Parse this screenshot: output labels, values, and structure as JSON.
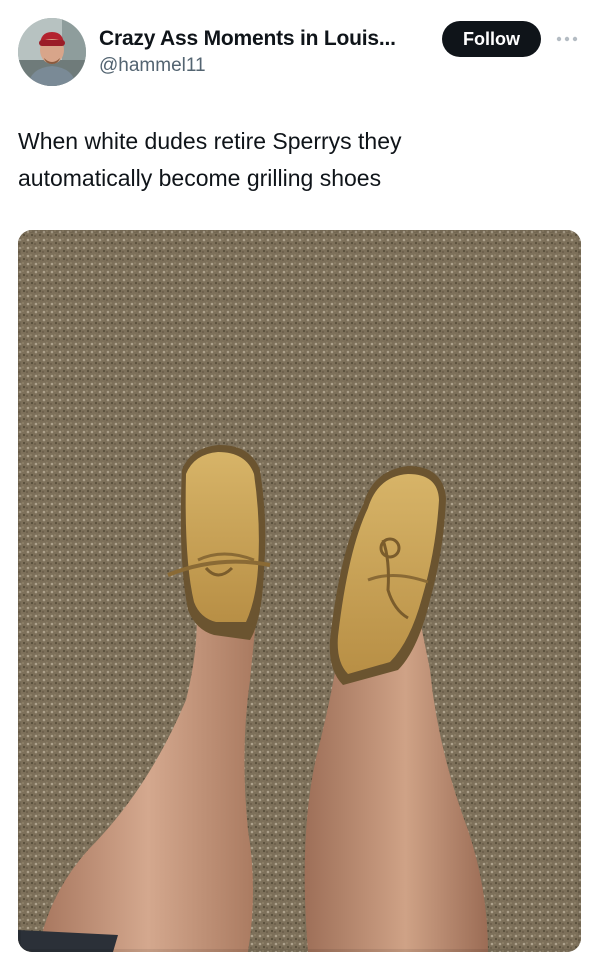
{
  "author": {
    "display_name": "Crazy Ass Moments in Louis...",
    "handle": "@hammel11",
    "avatar_icon": "profile-photo"
  },
  "actions": {
    "follow_label": "Follow",
    "more_icon": "more-horizontal-icon"
  },
  "tweet": {
    "text_line_1": "When white dudes retire Sperrys they",
    "text_line_2": "automatically become grilling shoes"
  },
  "media": {
    "type": "photo",
    "subject_icon": "legs-in-boat-shoes-on-carpet-photo"
  },
  "colors": {
    "text_primary": "#0f1419",
    "text_secondary": "#536471",
    "follow_bg": "#0f1419",
    "follow_text": "#ffffff",
    "carpet": "#8a7c64",
    "shoe": "#c9a45a",
    "skin": "#c99a7e"
  }
}
